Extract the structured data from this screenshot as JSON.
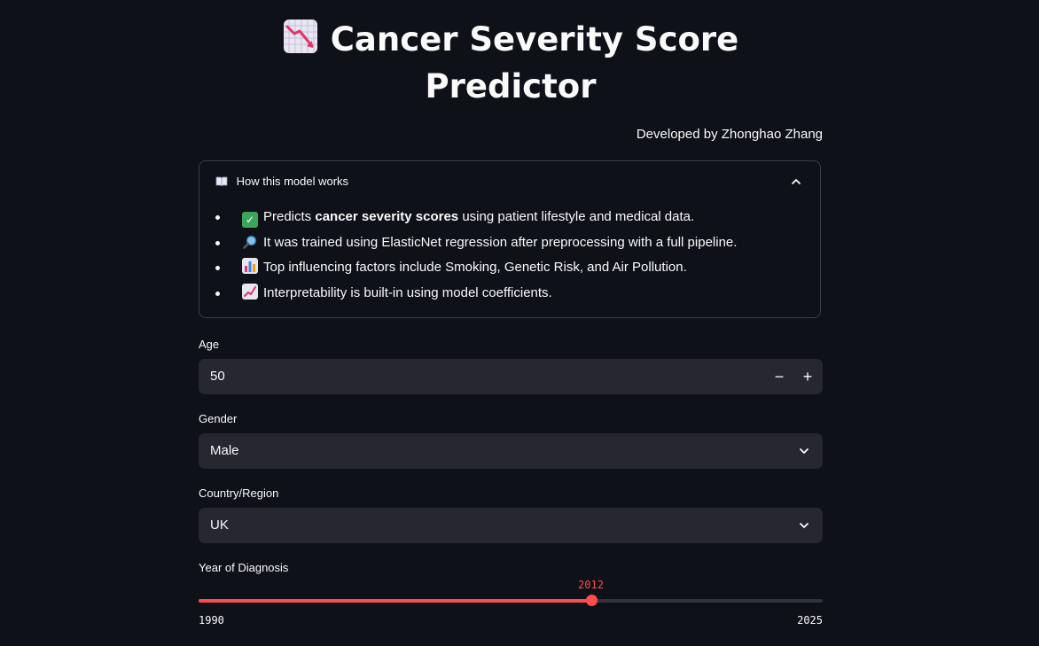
{
  "header": {
    "title": "Cancer Severity Score Predictor",
    "title_icon": "chart-decreasing-icon",
    "developer": "Developed by Zhonghao Zhang"
  },
  "expander": {
    "icon": "open-book-icon",
    "label": "How this model works",
    "expanded": true,
    "items": [
      {
        "icon": "check-mark-button-icon",
        "prefix": "Predicts ",
        "bold": "cancer severity scores",
        "suffix": " using patient lifestyle and medical data."
      },
      {
        "icon": "magnifying-glass-icon",
        "prefix": "It was trained using ElasticNet regression after preprocessing with a full pipeline.",
        "bold": "",
        "suffix": ""
      },
      {
        "icon": "bar-chart-icon",
        "prefix": "Top influencing factors include Smoking, Genetic Risk, and Air Pollution.",
        "bold": "",
        "suffix": ""
      },
      {
        "icon": "chart-increasing-icon",
        "prefix": "Interpretability is built-in using model coefficients.",
        "bold": "",
        "suffix": ""
      }
    ]
  },
  "form": {
    "age": {
      "label": "Age",
      "value": "50",
      "minus": "−",
      "plus": "+"
    },
    "gender": {
      "label": "Gender",
      "value": "Male"
    },
    "country": {
      "label": "Country/Region",
      "value": "UK"
    },
    "year": {
      "label": "Year of Diagnosis",
      "value": 2012,
      "min": 1990,
      "max": 2025
    }
  },
  "colors": {
    "background": "#0e1117",
    "widget": "#262730",
    "accent": "#ff4b4b",
    "border": "#3b3e48"
  }
}
